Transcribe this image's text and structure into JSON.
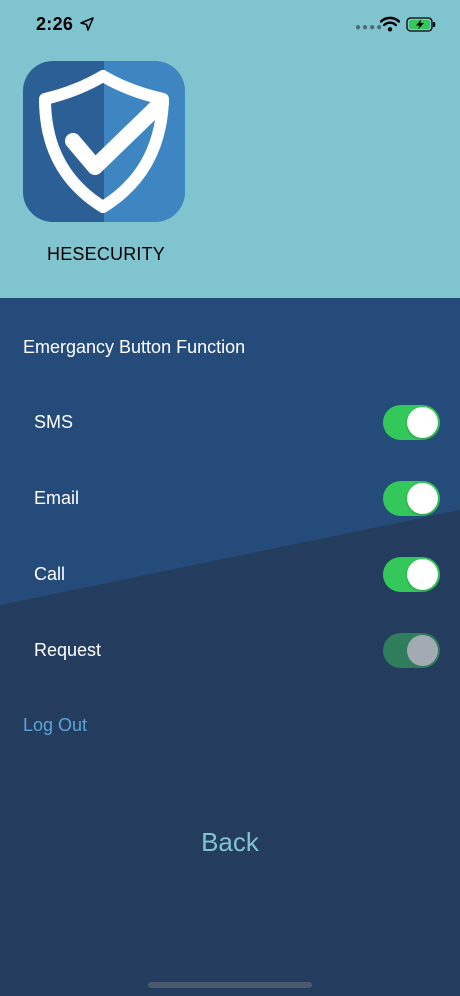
{
  "status_bar": {
    "time": "2:26",
    "location_icon": "location-arrow-icon",
    "signal_icon": "signal-dots-icon",
    "wifi_icon": "wifi-icon",
    "battery_icon": "battery-charging-icon"
  },
  "header": {
    "app_name": "HESECURITY",
    "logo_icon": "shield-check-logo",
    "background": "#80c4cf"
  },
  "settings": {
    "title": "Emergancy Button Function",
    "items": [
      {
        "label": "SMS",
        "on": true,
        "enabled": true
      },
      {
        "label": "Email",
        "on": true,
        "enabled": true
      },
      {
        "label": "Call",
        "on": true,
        "enabled": true
      },
      {
        "label": "Request",
        "on": true,
        "enabled": false
      }
    ]
  },
  "actions": {
    "logout_label": "Log Out",
    "back_label": "Back"
  },
  "colors": {
    "panel_top": "#244b7a",
    "panel_bottom": "#243d5f",
    "toggle_on": "#34c759",
    "link": "#5aa4d8",
    "back": "#80c4cf"
  }
}
